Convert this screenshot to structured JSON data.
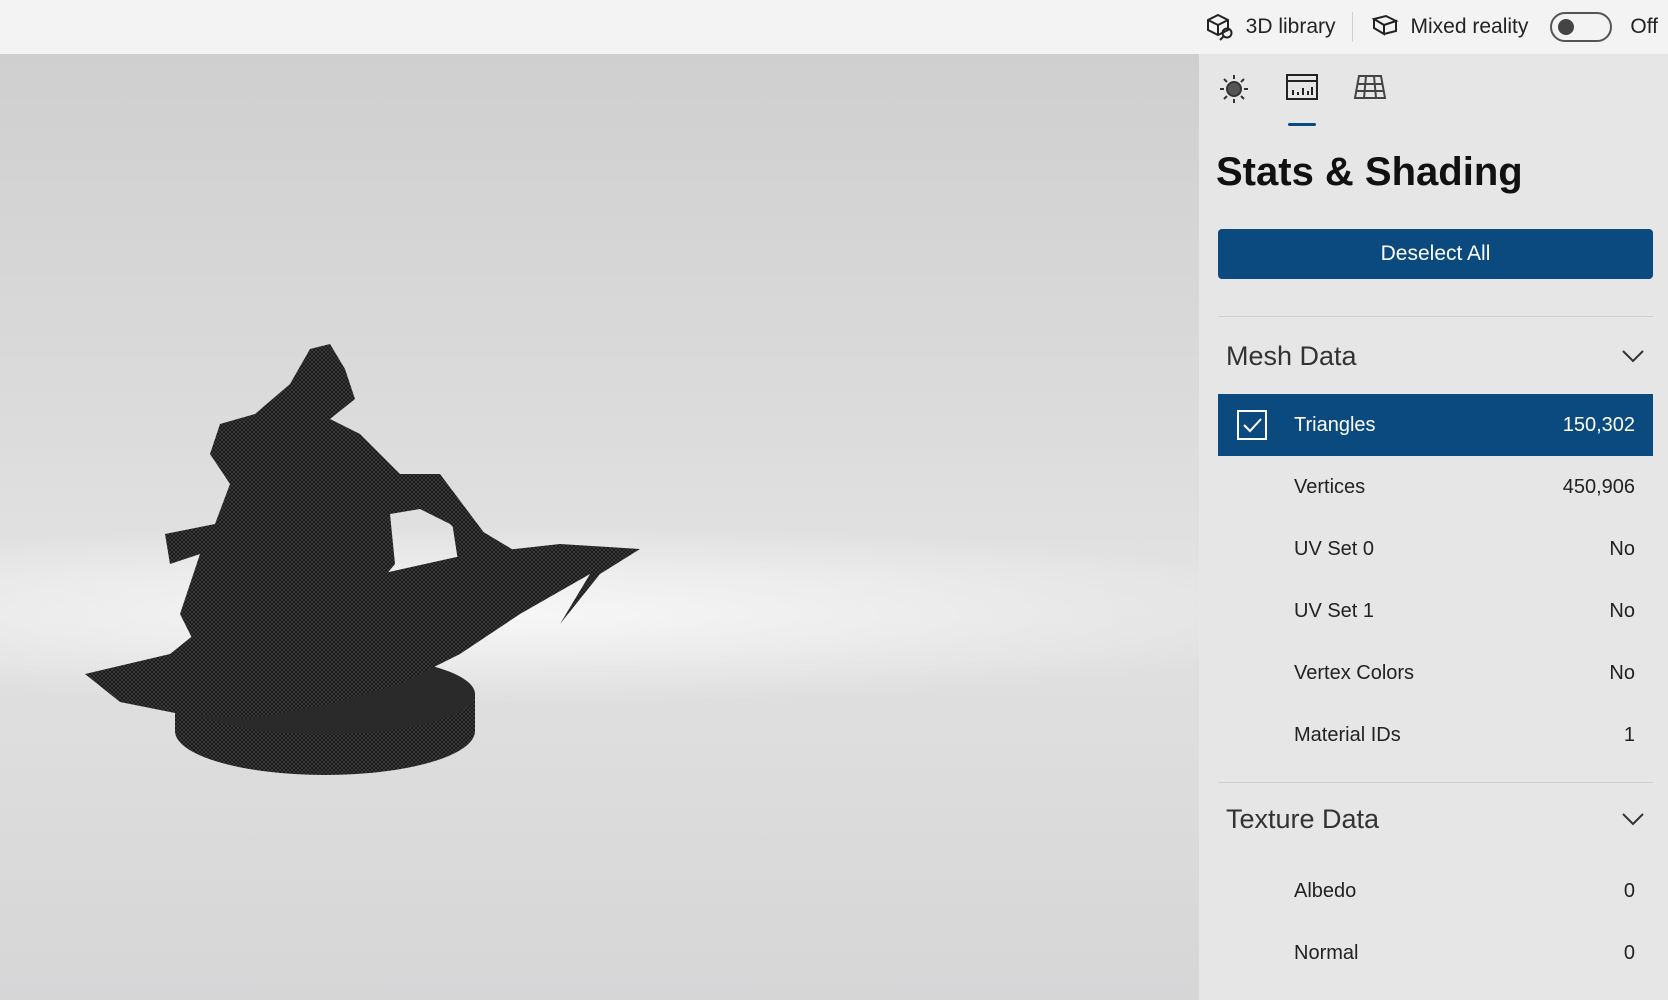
{
  "topbar": {
    "library_label": "3D library",
    "mixed_reality_label": "Mixed reality",
    "toggle_state": "Off",
    "toggle_on": false
  },
  "panel": {
    "tabs": [
      {
        "icon": "lighting-icon"
      },
      {
        "icon": "stats-icon",
        "active": true
      },
      {
        "icon": "grid-icon"
      }
    ],
    "title": "Stats & Shading",
    "deselect_label": "Deselect All",
    "mesh": {
      "header": "Mesh Data",
      "rows": [
        {
          "label": "Triangles",
          "value": "150,302",
          "selected": true
        },
        {
          "label": "Vertices",
          "value": "450,906"
        },
        {
          "label": "UV Set 0",
          "value": "No"
        },
        {
          "label": "UV Set 1",
          "value": "No"
        },
        {
          "label": "Vertex Colors",
          "value": "No"
        },
        {
          "label": "Material IDs",
          "value": "1"
        }
      ]
    },
    "texture": {
      "header": "Texture Data",
      "rows": [
        {
          "label": "Albedo",
          "value": "0"
        },
        {
          "label": "Normal",
          "value": "0"
        }
      ]
    }
  },
  "colors": {
    "accent": "#0b4a7f"
  }
}
